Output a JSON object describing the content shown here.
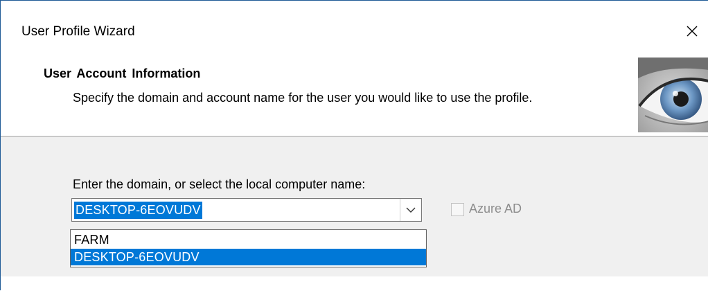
{
  "window": {
    "title": "User Profile Wizard",
    "close_glyph": "✕"
  },
  "header": {
    "title": "User Account Information",
    "subtitle": "Specify the domain and account name for the user you would like to use the profile.",
    "image_icon": "eye-icon"
  },
  "form": {
    "domain_label": "Enter the domain, or select the local computer name:",
    "domain_value": "DESKTOP-6EOVUDV",
    "dropdown_icon": "chevron-down-icon",
    "azure_label": "Azure AD",
    "azure_checked": false,
    "azure_enabled": false
  },
  "dropdown": {
    "open": true,
    "options": [
      {
        "label": "FARM",
        "selected": false
      },
      {
        "label": "DESKTOP-6EOVUDV",
        "selected": true
      }
    ]
  },
  "colors": {
    "accent": "#0078d7",
    "window_border": "#1e5a96",
    "body_bg": "#f0f0f0",
    "disabled_text": "#8d8d8d"
  }
}
